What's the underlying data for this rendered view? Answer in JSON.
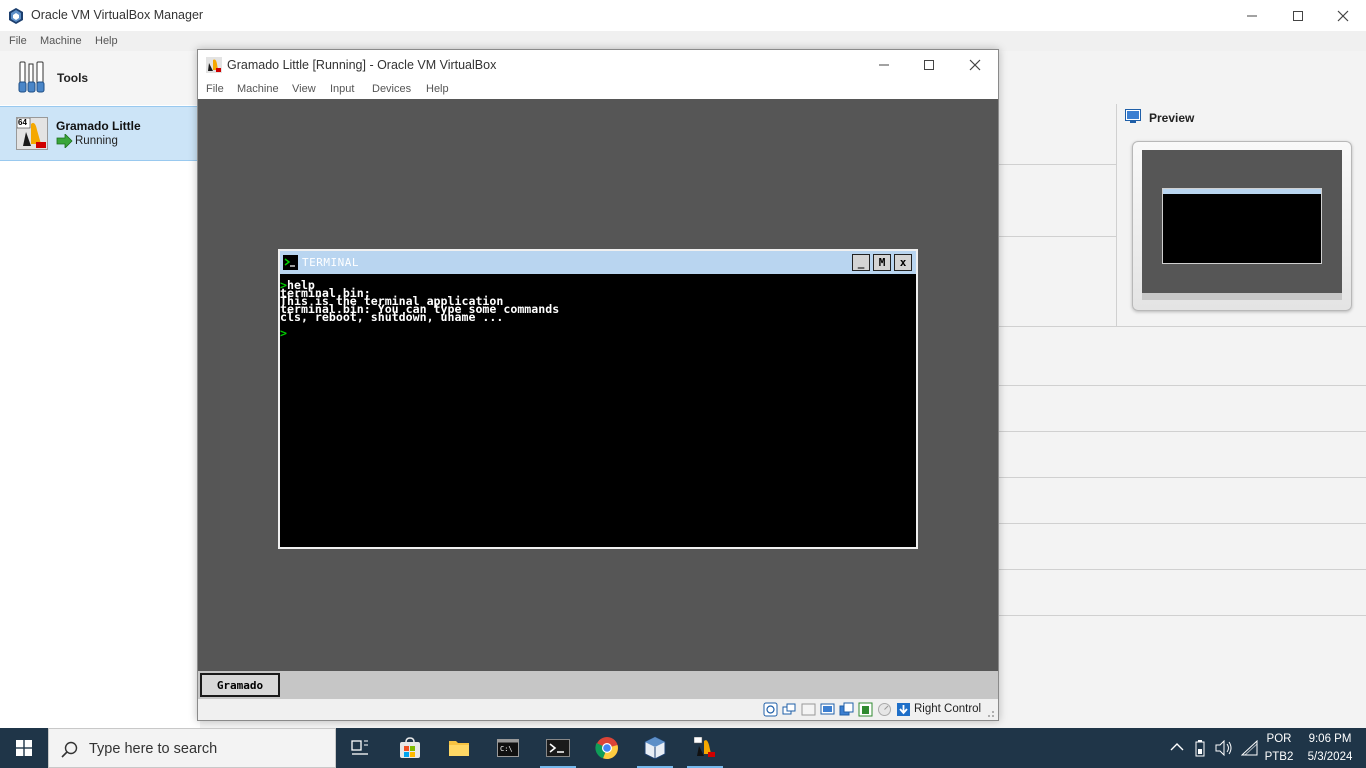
{
  "manager": {
    "title": "Oracle VM VirtualBox Manager",
    "menu": [
      "File",
      "Machine",
      "Help"
    ],
    "tools_label": "Tools",
    "vm_item": {
      "name": "Gramado Little",
      "state": "Running",
      "arch_badge": "64"
    },
    "preview_label": "Preview"
  },
  "vm_window": {
    "title": "Gramado Little [Running] - Oracle VM VirtualBox",
    "menu": [
      "File",
      "Machine",
      "View",
      "Input",
      "Devices",
      "Help"
    ],
    "host_key": "Right Control"
  },
  "guest": {
    "terminal_title": "TERMINAL",
    "buttons": [
      "_",
      "M",
      "x"
    ],
    "lines": [
      "help",
      "terminal.bin:",
      "This is the terminal application",
      "terminal.bin: You can type some commands",
      "cls, reboot, shutdown, uname ..."
    ],
    "prompt_symbol": ">",
    "taskbar_button": "Gramado"
  },
  "taskbar": {
    "search_placeholder": "Type here to search",
    "apps": [
      "task-view",
      "microsoft-store",
      "file-explorer",
      "command-prompt",
      "terminal",
      "chrome",
      "virtualbox",
      "gramado-vm"
    ],
    "tray": {
      "lang": "POR",
      "layout": "PTB2",
      "time": "9:06 PM",
      "date": "5/3/2024"
    }
  },
  "colors": {
    "accent": "#cce4f7",
    "guest_desktop": "#565656",
    "terminal_titlebar": "#b9d5f0",
    "prompt": "#00d000",
    "taskbar": "#1f3548"
  }
}
